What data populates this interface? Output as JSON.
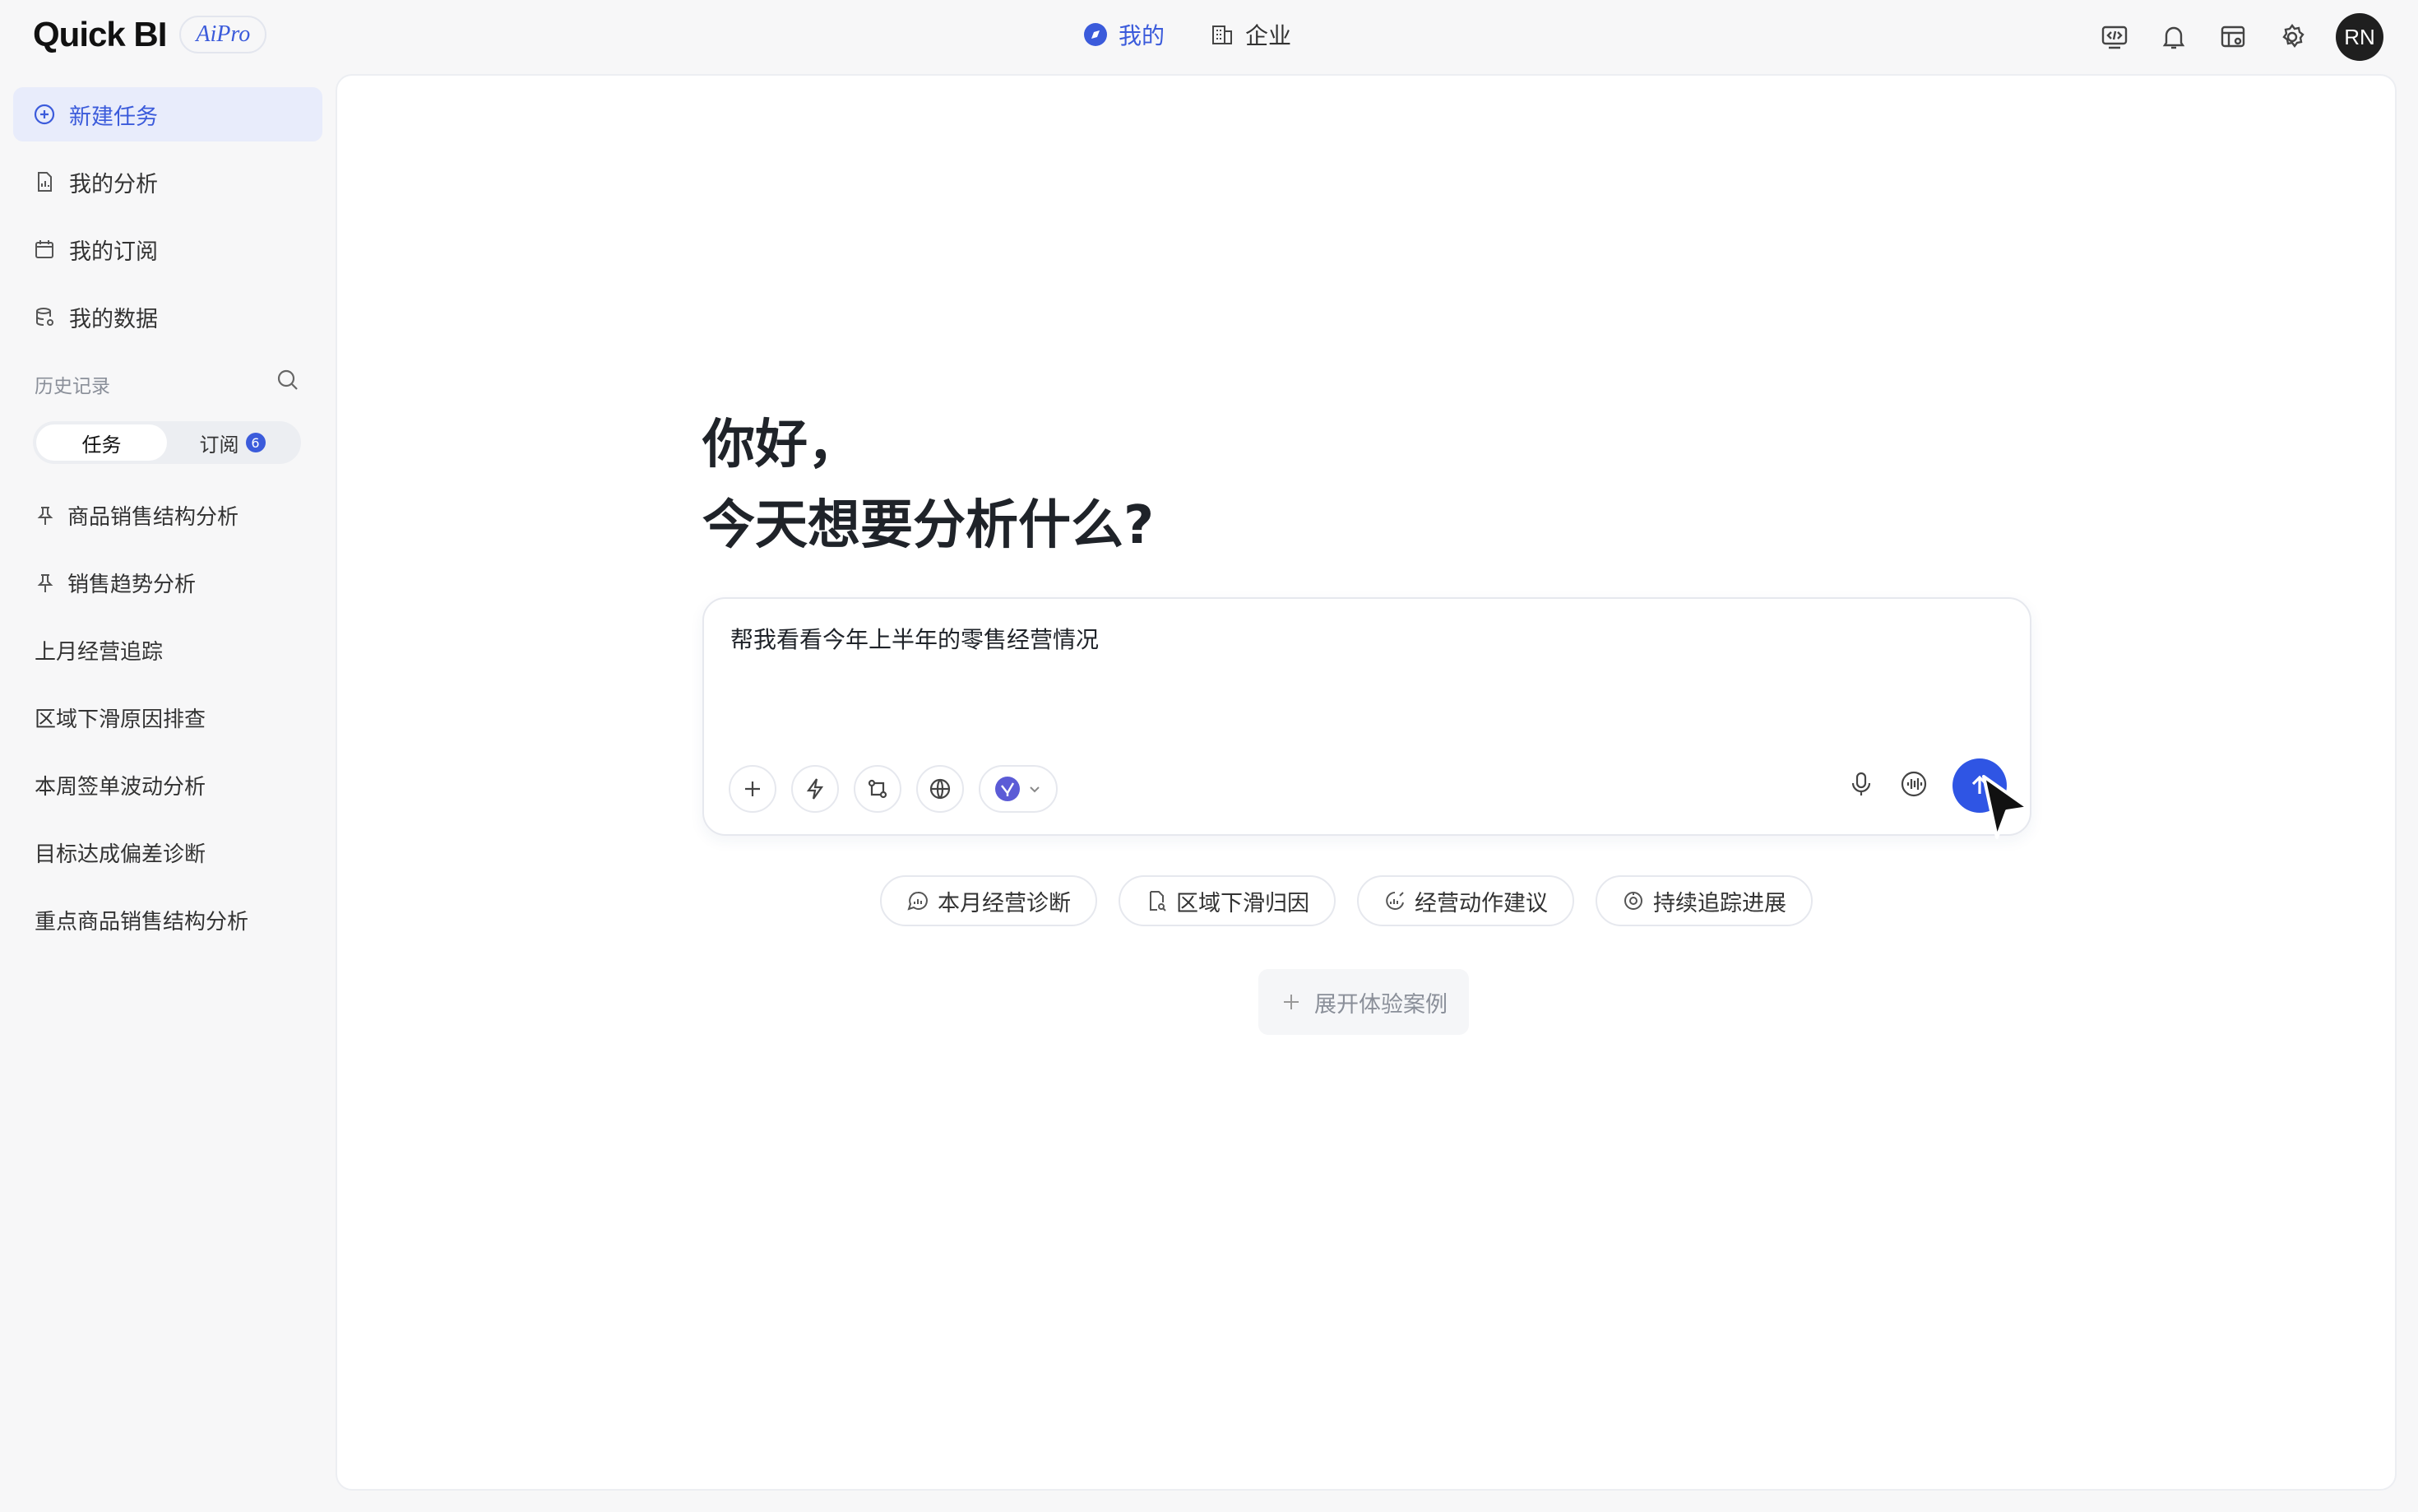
{
  "brand": {
    "name": "Quick BI",
    "badge": "AiPro"
  },
  "topnav": {
    "mine": "我的",
    "enterprise": "企业"
  },
  "user": {
    "initials": "RN"
  },
  "sidebar": {
    "new_task": "新建任务",
    "items": [
      "我的分析",
      "我的订阅",
      "我的数据"
    ],
    "history_label": "历史记录",
    "tabs": {
      "task": "任务",
      "subscribe": "订阅",
      "subscribe_count": "6"
    },
    "history": [
      {
        "label": "商品销售结构分析",
        "pinned": true
      },
      {
        "label": "销售趋势分析",
        "pinned": true
      },
      {
        "label": "上月经营追踪",
        "pinned": false
      },
      {
        "label": "区域下滑原因排查",
        "pinned": false
      },
      {
        "label": "本周签单波动分析",
        "pinned": false
      },
      {
        "label": "目标达成偏差诊断",
        "pinned": false
      },
      {
        "label": "重点商品销售结构分析",
        "pinned": false
      }
    ]
  },
  "main": {
    "greeting_line1": "你好，",
    "greeting_line2": "今天想要分析什么?",
    "input_value": "帮我看看今年上半年的零售经营情况",
    "chips": [
      "本月经营诊断",
      "区域下滑归因",
      "经营动作建议",
      "持续追踪进展"
    ],
    "expand_label": "展开体验案例"
  },
  "colors": {
    "accent": "#3b5bdb",
    "send": "#2f55e4"
  }
}
